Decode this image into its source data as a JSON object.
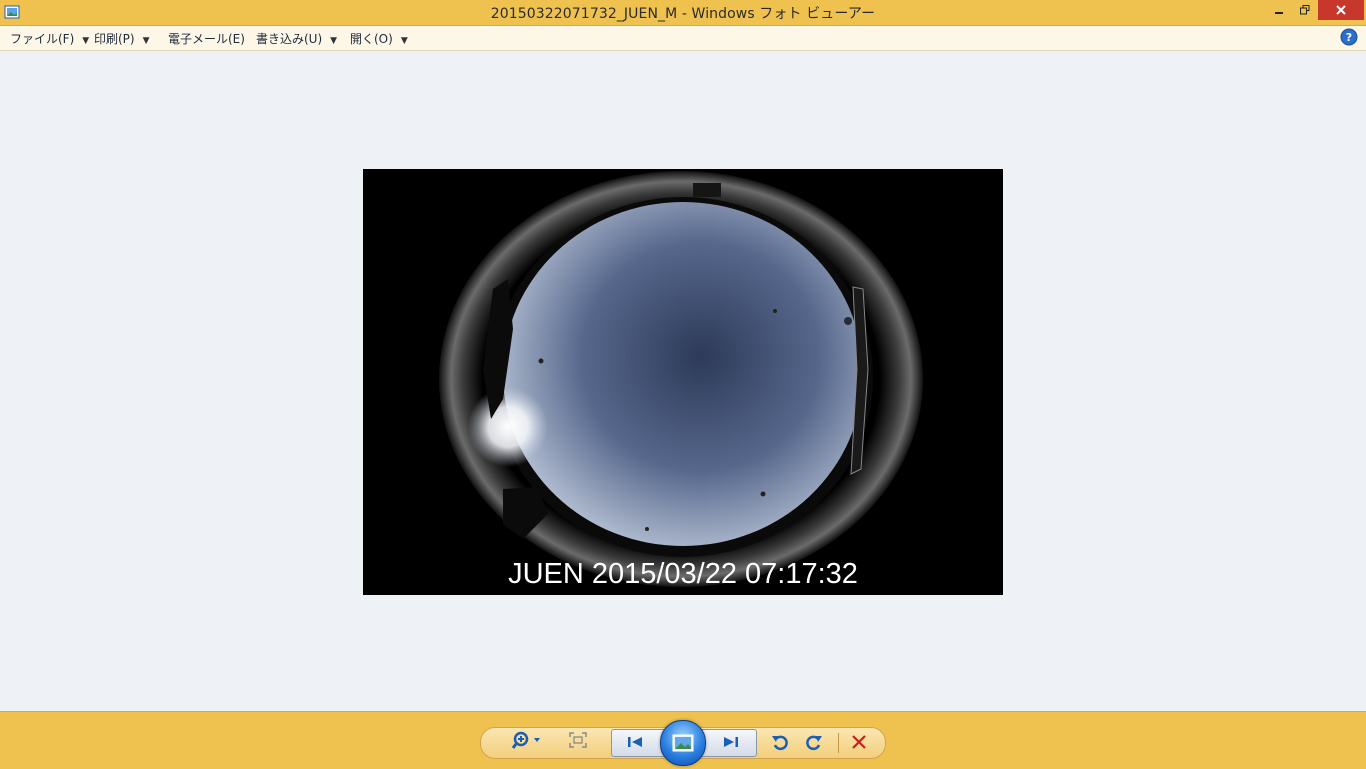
{
  "window": {
    "title": "20150322071732_JUEN_M - Windows フォト ビューアー"
  },
  "menu": {
    "items": [
      {
        "label": "ファイル(F)",
        "has_dropdown": true
      },
      {
        "label": "印刷(P)",
        "has_dropdown": true
      },
      {
        "label": "電子メール(E)",
        "has_dropdown": false
      },
      {
        "label": "書き込み(U)",
        "has_dropdown": true
      },
      {
        "label": "開く(O)",
        "has_dropdown": true
      }
    ],
    "help_icon": "help-icon"
  },
  "photo": {
    "caption": "JUEN 2015/03/22 07:17:32"
  },
  "toolbar": {
    "icons": [
      "zoom-icon",
      "actual-size-icon",
      "previous-icon",
      "slideshow-icon",
      "next-icon",
      "rotate-left-icon",
      "rotate-right-icon",
      "delete-icon"
    ]
  },
  "colors": {
    "titlebar": "#efc24f",
    "close_button": "#c7372c",
    "accent_blue": "#1a5fb4",
    "delete_red": "#c8201e"
  }
}
